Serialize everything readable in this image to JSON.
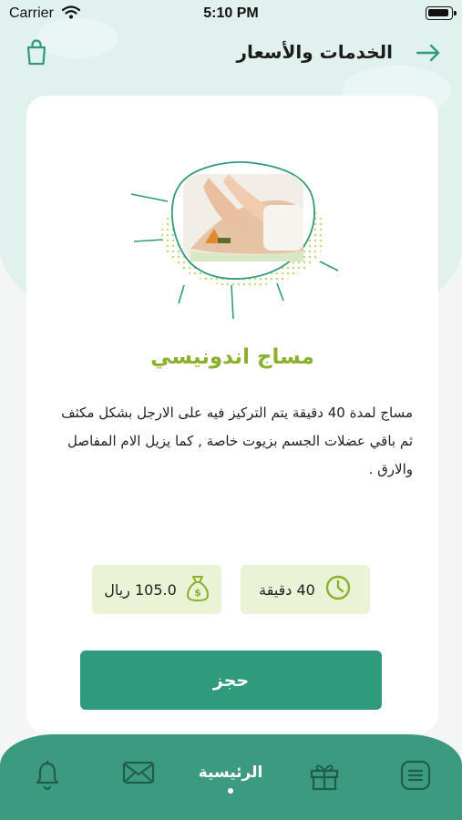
{
  "status_bar": {
    "carrier": "Carrier",
    "time": "5:10 PM"
  },
  "header": {
    "title": "الخدمات والأسعار",
    "back_icon": "arrow-right-icon",
    "cart_icon": "shopping-bag-icon"
  },
  "service": {
    "title": "مساج اندونيسي",
    "description": "مساج لمدة 40 دقيقة  يتم التركيز فيه على الارجل بشكل مكثف ثم باقي عضلات الجسم بزيوت خاصة , كما يزيل الام المفاصل والارق .",
    "duration": "40 دقيقة",
    "price": "105.0 ريال",
    "duration_icon": "clock-icon",
    "price_icon": "money-bag-icon"
  },
  "actions": {
    "book_label": "حجز"
  },
  "tab_bar": {
    "home_label": "الرئيسية",
    "tabs": [
      "bell-icon",
      "mail-icon",
      "home",
      "gift-icon",
      "menu-list-icon"
    ]
  },
  "colors": {
    "primary": "#2f9a7c",
    "tab_bar": "#3c9a80",
    "accent_green": "#8ab02c",
    "info_bg": "#eaf3d6",
    "top_bg": "#e1f1ee"
  }
}
